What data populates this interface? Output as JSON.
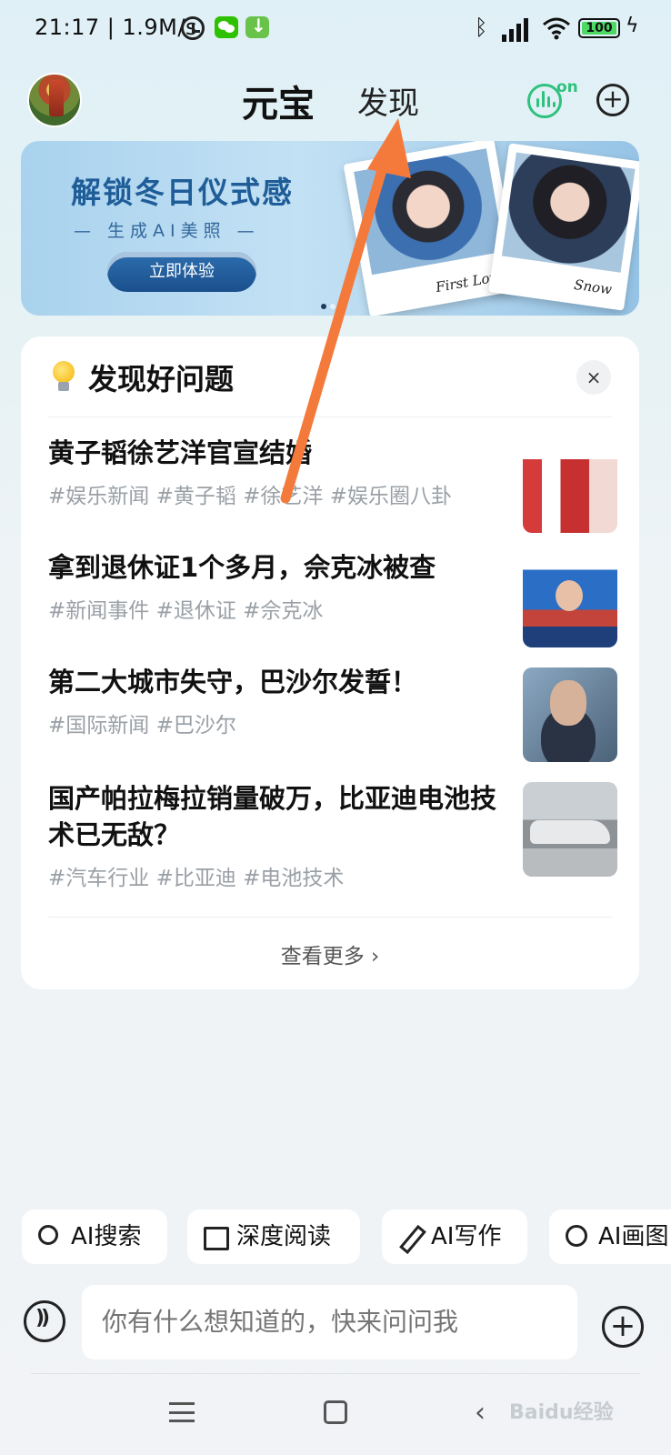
{
  "status_bar": {
    "time": "21:17 | 1.9M/s",
    "battery": "100"
  },
  "header": {
    "tab_primary": "元宝",
    "tab_secondary": "发现",
    "voice_badge": "on"
  },
  "banner": {
    "title": "解锁冬日仪式感",
    "subtitle": "— 生成AI美照 —",
    "button": "立即体验",
    "photo1_caption": "First Love",
    "photo2_caption": "Snow"
  },
  "discover": {
    "title": "发现好问题",
    "close_icon": "×",
    "items": [
      {
        "question": "黄子韬徐艺洋官宣结婚",
        "tags": "#娱乐新闻 #黄子韬 #徐艺洋 #娱乐圈八卦"
      },
      {
        "question": "拿到退休证1个多月，佘克冰被查",
        "tags": "#新闻事件 #退休证 #佘克冰"
      },
      {
        "question": "第二大城市失守，巴沙尔发誓！",
        "tags": "#国际新闻 #巴沙尔"
      },
      {
        "question": "国产帕拉梅拉销量破万，比亚迪电池技术已无敌？",
        "tags": "#汽车行业 #比亚迪 #电池技术"
      }
    ],
    "more": "查看更多 ›"
  },
  "chips": [
    "AI搜索",
    "深度阅读",
    "AI写作",
    "AI画图"
  ],
  "input": {
    "placeholder": "你有什么想知道的，快来问问我"
  },
  "watermark": "Baidu经验",
  "colors": {
    "accent_green": "#2ec27e",
    "banner_blue": "#1f5d98",
    "arrow_orange": "#f47a3c"
  }
}
